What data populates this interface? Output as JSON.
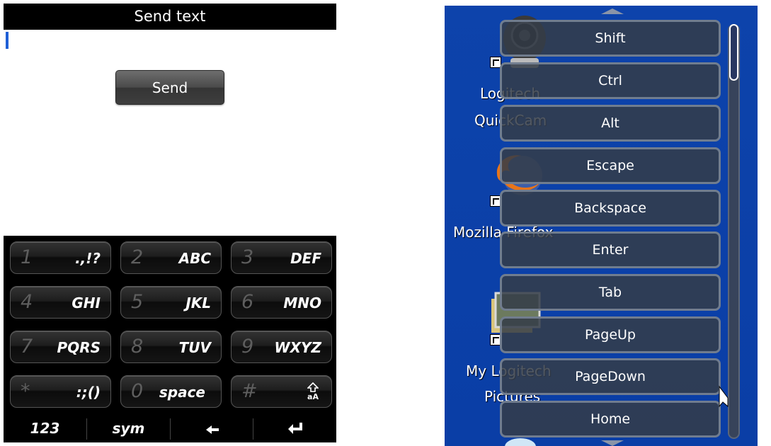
{
  "left_screen": {
    "title": "Send text",
    "send_button": "Send",
    "keys": [
      {
        "num": "1",
        "letters": ".,!?"
      },
      {
        "num": "2",
        "letters": "ABC"
      },
      {
        "num": "3",
        "letters": "DEF"
      },
      {
        "num": "4",
        "letters": "GHI"
      },
      {
        "num": "5",
        "letters": "JKL"
      },
      {
        "num": "6",
        "letters": "MNO"
      },
      {
        "num": "7",
        "letters": "PQRS"
      },
      {
        "num": "8",
        "letters": "TUV"
      },
      {
        "num": "9",
        "letters": "WXYZ"
      },
      {
        "num": "*",
        "letters": ":;()"
      },
      {
        "num": "0",
        "letters": "space"
      },
      {
        "num": "#",
        "letters": "aA",
        "icon": "shift-arrow-icon"
      }
    ],
    "bottom_bar": {
      "mode_123": "123",
      "sym": "sym",
      "backspace_icon": "left-arrow-icon",
      "enter_icon": "enter-icon"
    },
    "colors": {
      "caret": "#1f5fd6",
      "title_bg": "#000000"
    }
  },
  "right_screen": {
    "desktop_icons": [
      {
        "label_line1": "Logitech",
        "label_line2": "QuickCam",
        "icon": "webcam-icon"
      },
      {
        "label_line1": "Mozilla Firefox",
        "icon": "firefox-icon"
      },
      {
        "label_line1": "My Logitech",
        "label_line2": "Pictures",
        "icon": "pictures-folder-icon"
      }
    ],
    "menu_items": [
      "Shift",
      "Ctrl",
      "Alt",
      "Escape",
      "Backspace",
      "Enter",
      "Tab",
      "PageUp",
      "PageDown",
      "Home"
    ],
    "colors": {
      "desktop": "#0b3fa8",
      "menu_button": "#343c48"
    }
  }
}
